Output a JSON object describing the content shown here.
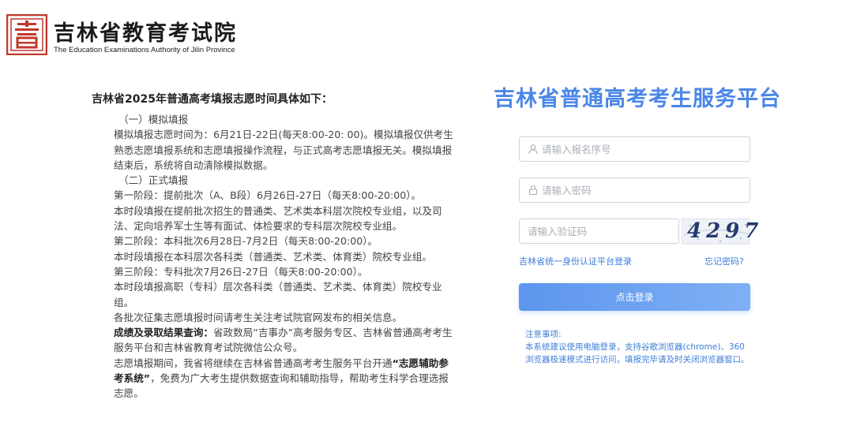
{
  "header": {
    "logo_title": "吉林省教育考试院",
    "logo_subtitle": "The Education Examinations Authority of Jilin Province",
    "logo_color": "#c0392b"
  },
  "notice": {
    "title": "吉林省2025年普通高考填报志愿时间具体如下：",
    "section1_heading": "（一）模拟填报",
    "section1_text": "模拟填报志愿时间为：6月21日-22日(每天8:00-20: 00)。模拟填报仅供考生熟悉志愿填报系统和志愿填报操作流程，与正式高考志愿填报无关。模拟填报结束后，系统将自动清除模拟数据。",
    "section2_heading": "（二）正式填报",
    "stage1": "第一阶段：提前批次（A、B段）6月26日-27日（每天8:00-20:00）。",
    "stage1_desc": "本时段填报在提前批次招生的普通类、艺术类本科层次院校专业组，以及司法、定向培养军士生等有面试、体检要求的专科层次院校专业组。",
    "stage2": "第二阶段：本科批次6月28日-7月2日（每天8:00-20:00）。",
    "stage2_desc": "本时段填报在本科层次各科类（普通类、艺术类、体育类）院校专业组。",
    "stage3": "第三阶段：专科批次7月26日-27日（每天8:00-20:00）。",
    "stage3_desc": "本时段填报高职（专科）层次各科类（普通类、艺术类、体育类）院校专业组。",
    "supplement": "各批次征集志愿填报时间请考生关注考试院官网发布的相关信息。",
    "results_label": "成绩及录取结果查询：",
    "results_text": "省政数局“吉事办”高考服务专区、吉林省普通高考考生服务平台和吉林省教育考试院微信公众号。",
    "assist_text_before": "志愿填报期间，我省将继续在吉林省普通高考考生服务平台开通",
    "assist_label": "“志愿辅助参考系统”",
    "assist_text_after": "，免费为广大考生提供数据查询和辅助指导，帮助考生科学合理选报志愿。"
  },
  "login": {
    "platform_title": "吉林省普通高考考生服务平台",
    "username_placeholder": "请输入报名序号",
    "password_placeholder": "请输入密码",
    "captcha_placeholder": "请输入验证码",
    "captcha_text": "4297",
    "id_auth_link": "吉林省统一身份认证平台登录",
    "forgot_link": "忘记密码?",
    "login_button": "点击登录",
    "accent_color": "#4a86e8"
  },
  "tips": {
    "title": "注意事项:",
    "text": "本系统建议使用电脑登录，支持谷歌浏览器(chrome)、360浏览器极速模式进行访问，填报完毕请及时关闭浏览器窗口。"
  }
}
